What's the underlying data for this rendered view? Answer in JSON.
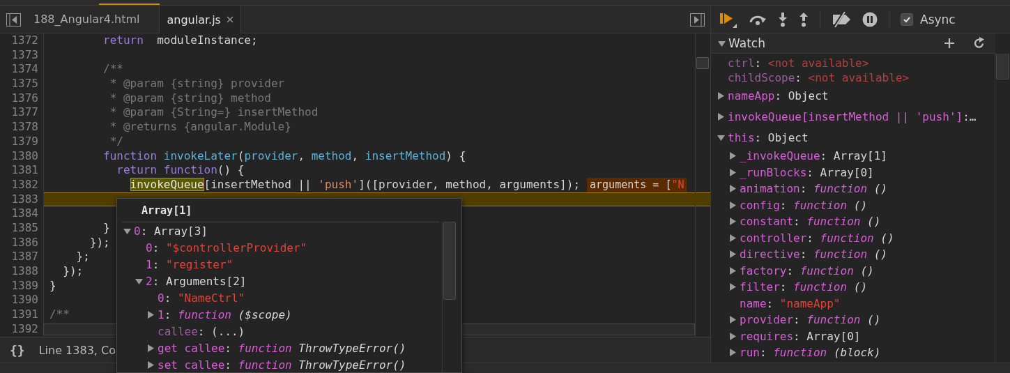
{
  "editor": {
    "tabs": [
      {
        "label": "188_Angular4.html",
        "selected": false,
        "closable": false
      },
      {
        "label": "angular.js",
        "selected": true,
        "closable": true
      }
    ],
    "lines": [
      {
        "number": "1372",
        "current": false,
        "tokens": [
          {
            "kind": "keyword",
            "text": "        return"
          },
          {
            "kind": "plain",
            "text": "  moduleInstance;"
          }
        ]
      },
      {
        "number": "1373",
        "current": false
      },
      {
        "number": "1374",
        "current": false,
        "tokens": [
          {
            "kind": "comment",
            "text": "        /**"
          }
        ]
      },
      {
        "number": "1375",
        "current": false,
        "tokens": [
          {
            "kind": "comment",
            "text": "         * @param {string} provider"
          }
        ]
      },
      {
        "number": "1376",
        "current": false,
        "tokens": [
          {
            "kind": "comment",
            "text": "         * @param {string} method"
          }
        ]
      },
      {
        "number": "1377",
        "current": false,
        "tokens": [
          {
            "kind": "comment",
            "text": "         * @param {String=} insertMethod"
          }
        ]
      },
      {
        "number": "1378",
        "current": false,
        "tokens": [
          {
            "kind": "comment",
            "text": "         * @returns {angular.Module}"
          }
        ]
      },
      {
        "number": "1379",
        "current": false,
        "tokens": [
          {
            "kind": "comment",
            "text": "         */"
          }
        ]
      },
      {
        "number": "1380",
        "current": false,
        "tokens": [
          {
            "kind": "keyword",
            "text": "        function "
          },
          {
            "kind": "name",
            "text": "invokeLater"
          },
          {
            "kind": "plain",
            "text": "("
          },
          {
            "kind": "name",
            "text": "provider"
          },
          {
            "kind": "plain",
            "text": ", "
          },
          {
            "kind": "name",
            "text": "method"
          },
          {
            "kind": "plain",
            "text": ", "
          },
          {
            "kind": "name",
            "text": "insertMethod"
          },
          {
            "kind": "plain",
            "text": ") {"
          }
        ]
      },
      {
        "number": "1381",
        "current": false,
        "tokens": [
          {
            "kind": "keyword",
            "text": "          return function"
          },
          {
            "kind": "plain",
            "text": "() {"
          }
        ]
      },
      {
        "number": "1382",
        "current": false,
        "tokens": [
          {
            "kind": "hover",
            "text": "            invokeQueue"
          },
          {
            "kind": "plain",
            "text": "[insertMethod || "
          },
          {
            "kind": "string",
            "text": "'push'"
          },
          {
            "kind": "plain",
            "text": "]([provider, method, arguments]);"
          }
        ],
        "inline_value": [
          {
            "kind": "plain",
            "text": "arguments = ["
          },
          {
            "kind": "string",
            "text": "\"N"
          }
        ]
      },
      {
        "number": "1383",
        "current": true
      },
      {
        "number": "1384",
        "current": false
      },
      {
        "number": "1385",
        "current": false,
        "tokens": [
          {
            "kind": "plain",
            "text": "        }"
          }
        ]
      },
      {
        "number": "1386",
        "current": false,
        "tokens": [
          {
            "kind": "plain",
            "text": "      });"
          }
        ]
      },
      {
        "number": "1387",
        "current": false,
        "tokens": [
          {
            "kind": "plain",
            "text": "    };"
          }
        ]
      },
      {
        "number": "1388",
        "current": false,
        "tokens": [
          {
            "kind": "plain",
            "text": "  });"
          }
        ]
      },
      {
        "number": "1389",
        "current": false,
        "tokens": [
          {
            "kind": "plain",
            "text": "}"
          }
        ]
      },
      {
        "number": "1390",
        "current": false
      },
      {
        "number": "1391",
        "current": false,
        "tokens": [
          {
            "kind": "comment",
            "text": "/**"
          }
        ]
      },
      {
        "number": "1392",
        "current": false
      }
    ],
    "status": {
      "format_button": "{}",
      "position": "Line 1383, Co"
    }
  },
  "popover": {
    "title": "Array[1]",
    "items": [
      {
        "key": "0",
        "colon": ":",
        "kind": "object",
        "value": "Array[3]",
        "expanded": true,
        "children": [
          {
            "key": "0",
            "colon": ":",
            "kind": "string",
            "value": "\"$controllerProvider\""
          },
          {
            "key": "1",
            "colon": ":",
            "kind": "string",
            "value": "\"register\""
          },
          {
            "key": "2",
            "colon": ":",
            "kind": "object",
            "value": "Arguments[2]",
            "expanded": true,
            "children": [
              {
                "key": "0",
                "colon": ":",
                "kind": "string",
                "value": "\"NameCtrl\""
              },
              {
                "key": "1",
                "colon": ":",
                "kind": "function",
                "value": "function",
                "signature": "($scope)",
                "expanded": false
              },
              {
                "key": "callee",
                "colon": ":",
                "kind": "lazy",
                "value": "(...)"
              },
              {
                "key": "get callee",
                "colon": ":",
                "kind": "function",
                "value": "function",
                "signature": "ThrowTypeError()",
                "expanded": false
              },
              {
                "key": "set callee",
                "colon": ":",
                "kind": "function",
                "value": "function",
                "signature": "ThrowTypeError()",
                "expanded": false
              }
            ]
          }
        ]
      }
    ]
  },
  "sidebar": {
    "toolbar": {
      "buttons": [
        {
          "kind": "resume"
        },
        {
          "kind": "step-over"
        },
        {
          "kind": "step-into"
        },
        {
          "kind": "step-out"
        },
        {
          "kind": "separator"
        },
        {
          "kind": "deactivate-breakpoints"
        },
        {
          "kind": "pause-on-exceptions"
        },
        {
          "kind": "separator"
        }
      ],
      "async": {
        "label": "Async",
        "checked": true
      }
    },
    "watch": {
      "title": "Watch",
      "expanded": true,
      "items": [
        {
          "key": "ctrl",
          "colon": ":",
          "kind": "unavailable",
          "value": "<not available>"
        },
        {
          "key": "childScope",
          "colon": ":",
          "kind": "unavailable",
          "value": "<not available>"
        },
        {
          "key": "nameApp",
          "colon": ":",
          "kind": "object",
          "value": "Object",
          "expanded": false
        },
        {
          "key": "invokeQueue[insertMethod || 'push']",
          "colon": ":",
          "kind": "truncated",
          "value": "…",
          "expanded": false
        },
        {
          "key": "this",
          "colon": ":",
          "kind": "object",
          "value": "Object",
          "expanded": true,
          "children": [
            {
              "key": "_invokeQueue",
              "colon": ":",
              "kind": "object",
              "value": "Array[1]",
              "expanded": false
            },
            {
              "key": "_runBlocks",
              "colon": ":",
              "kind": "object",
              "value": "Array[0]",
              "expanded": false
            },
            {
              "key": "animation",
              "colon": ":",
              "kind": "function",
              "value": "function",
              "signature": "()",
              "expanded": false
            },
            {
              "key": "config",
              "colon": ":",
              "kind": "function",
              "value": "function",
              "signature": "()",
              "expanded": false
            },
            {
              "key": "constant",
              "colon": ":",
              "kind": "function",
              "value": "function",
              "signature": "()",
              "expanded": false
            },
            {
              "key": "controller",
              "colon": ":",
              "kind": "function",
              "value": "function",
              "signature": "()",
              "expanded": false
            },
            {
              "key": "directive",
              "colon": ":",
              "kind": "function",
              "value": "function",
              "signature": "()",
              "expanded": false
            },
            {
              "key": "factory",
              "colon": ":",
              "kind": "function",
              "value": "function",
              "signature": "()",
              "expanded": false
            },
            {
              "key": "filter",
              "colon": ":",
              "kind": "function",
              "value": "function",
              "signature": "()",
              "expanded": false
            },
            {
              "key": "name",
              "colon": ":",
              "kind": "string",
              "value": "\"nameApp\""
            },
            {
              "key": "provider",
              "colon": ":",
              "kind": "function",
              "value": "function",
              "signature": "()",
              "expanded": false
            },
            {
              "key": "requires",
              "colon": ":",
              "kind": "object",
              "value": "Array[0]",
              "expanded": false
            },
            {
              "key": "run",
              "colon": ":",
              "kind": "function",
              "value": "function",
              "signature": "(block)",
              "expanded": false
            }
          ]
        }
      ]
    }
  }
}
